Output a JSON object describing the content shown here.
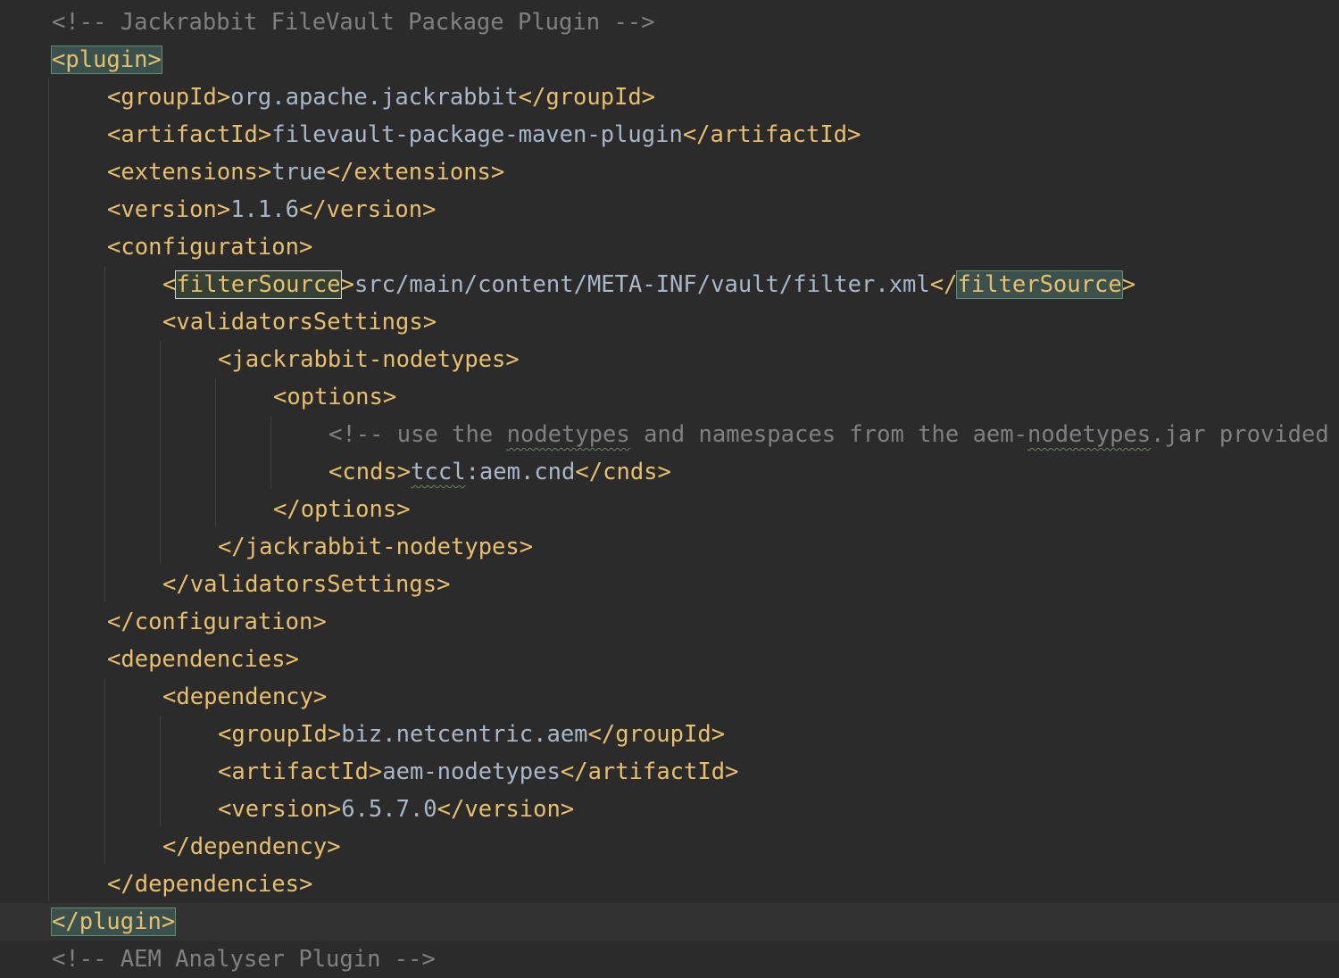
{
  "editor": {
    "lines": [
      {
        "comment": "<!-- Jackrabbit FileVault Package Plugin -->"
      },
      {
        "open": "plugin"
      },
      {
        "tag": "groupId",
        "value": "org.apache.jackrabbit"
      },
      {
        "tag": "artifactId",
        "value": "filevault-package-maven-plugin"
      },
      {
        "tag": "extensions",
        "value": "true"
      },
      {
        "tag": "version",
        "value": "1.1.6"
      },
      {
        "open": "configuration"
      },
      {
        "tag": "filterSource",
        "value": "src/main/content/META-INF/vault/filter.xml"
      },
      {
        "open": "validatorsSettings"
      },
      {
        "open": "jackrabbit-nodetypes"
      },
      {
        "open": "options"
      },
      {
        "comment_parts": [
          "<!-- use the ",
          "nodetypes",
          " and namespaces from the aem-",
          "nodetypes",
          ".jar provided"
        ]
      },
      {
        "tag": "cnds",
        "value_parts": [
          "tccl",
          ":aem.cnd"
        ]
      },
      {
        "close": "options"
      },
      {
        "close": "jackrabbit-nodetypes"
      },
      {
        "close": "validatorsSettings"
      },
      {
        "close": "configuration"
      },
      {
        "open": "dependencies"
      },
      {
        "open": "dependency"
      },
      {
        "tag": "groupId",
        "value": "biz.netcentric.aem"
      },
      {
        "tag": "artifactId",
        "value": "aem-nodetypes"
      },
      {
        "tag": "version",
        "value": "6.5.7.0"
      },
      {
        "close": "dependency"
      },
      {
        "close": "dependencies"
      },
      {
        "close": "plugin"
      },
      {
        "comment": "<!-- AEM Analyser Plugin -->"
      }
    ]
  },
  "colors": {
    "background": "#2b2b2b",
    "tag": "#e8bf6a",
    "text": "#a9b7c6",
    "comment": "#808080",
    "current_line": "#323232",
    "tag_match_highlight": "#3b514d"
  }
}
